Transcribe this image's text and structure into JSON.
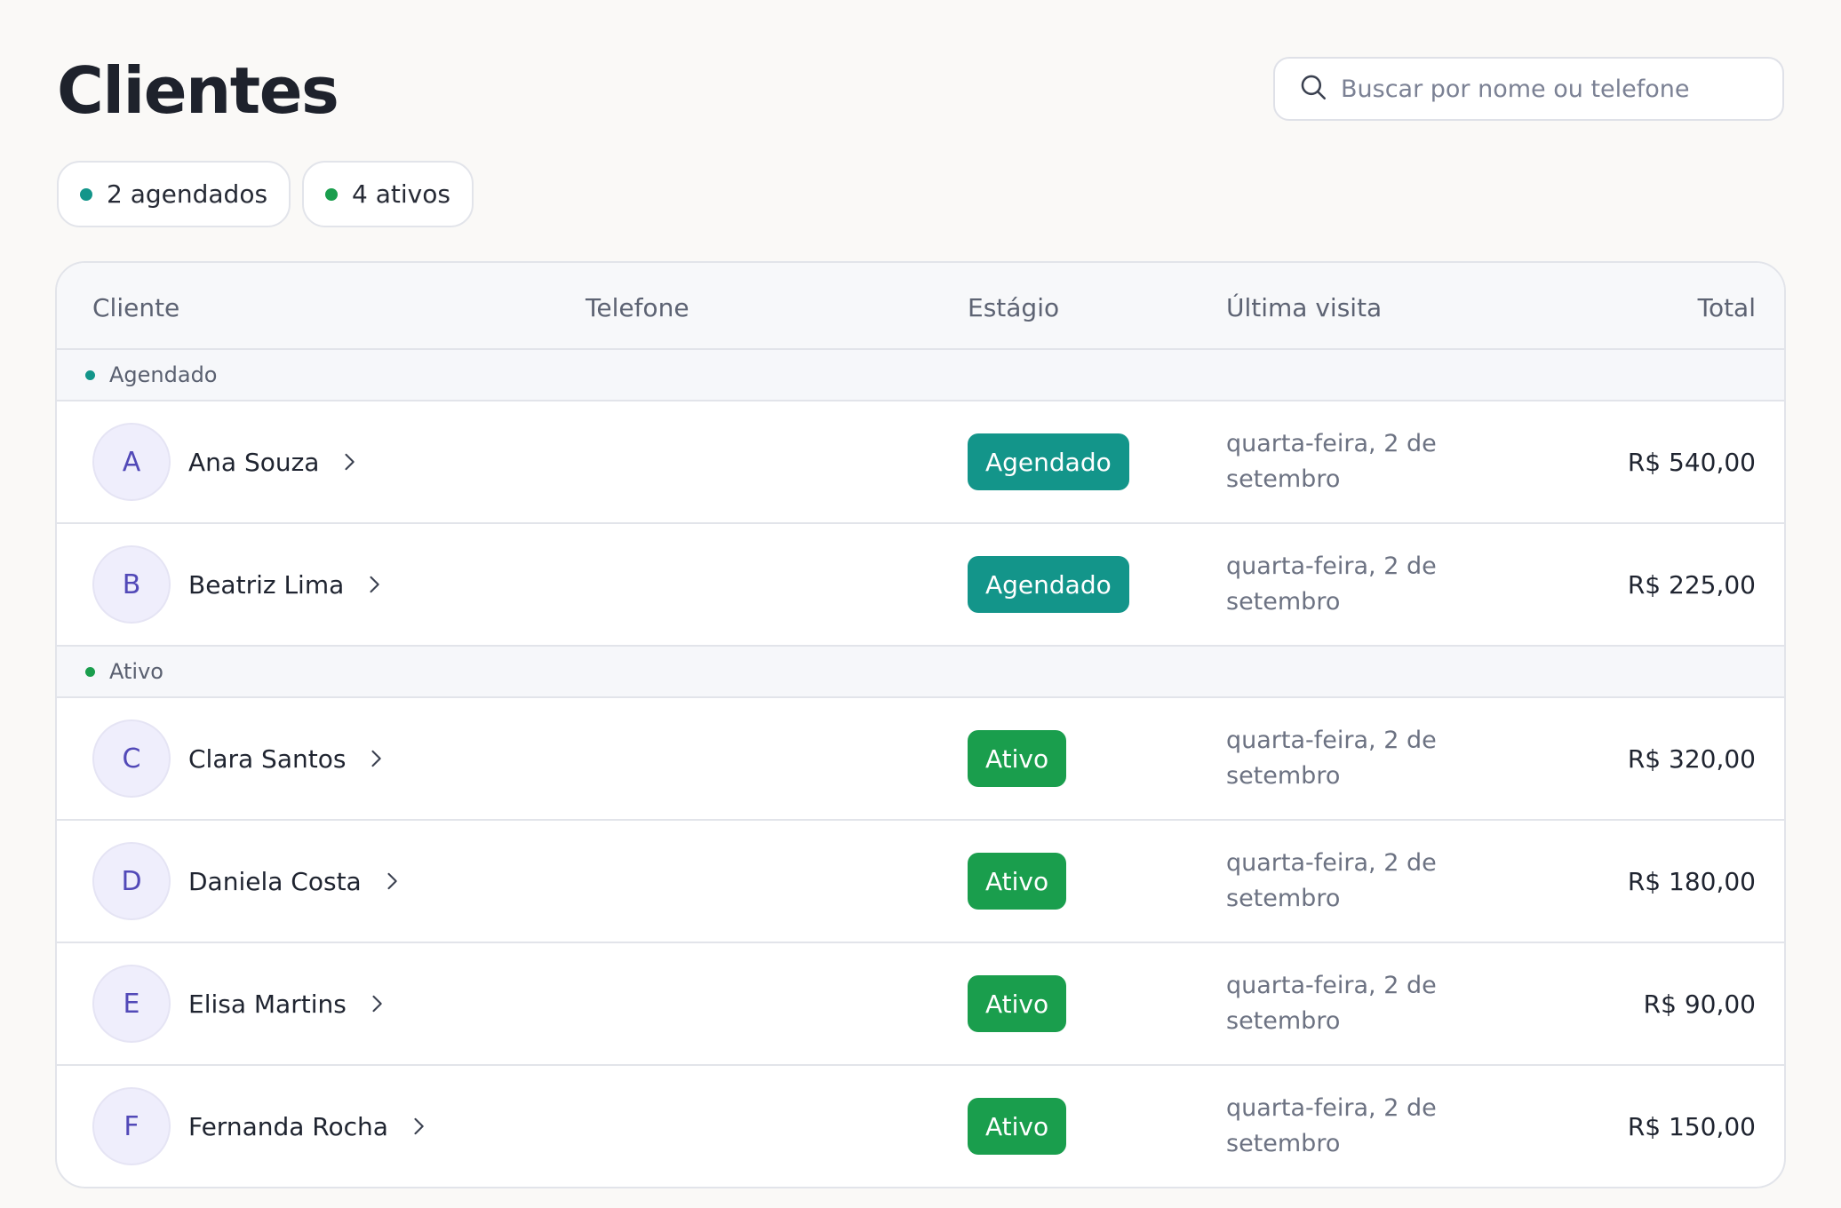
{
  "header": {
    "title": "Clientes",
    "search_placeholder": "Buscar por nome ou telefone"
  },
  "chips": [
    {
      "label": "2 agendados",
      "dot_color": "#13958a"
    },
    {
      "label": "4 ativos",
      "dot_color": "#1a9e4d"
    }
  ],
  "table": {
    "columns": {
      "cliente": "Cliente",
      "telefone": "Telefone",
      "estagio": "Estágio",
      "ultima_visita": "Última visita",
      "total": "Total"
    },
    "groups": [
      {
        "label": "Agendado",
        "color": "#13958a",
        "rows": [
          {
            "initial": "A",
            "name": "Ana Souza",
            "stage": "Agendado",
            "last_visit": "quarta-feira, 2 de setembro",
            "total": "R$ 540,00"
          },
          {
            "initial": "B",
            "name": "Beatriz Lima",
            "stage": "Agendado",
            "last_visit": "quarta-feira, 2 de setembro",
            "total": "R$ 225,00"
          }
        ]
      },
      {
        "label": "Ativo",
        "color": "#1a9e4d",
        "rows": [
          {
            "initial": "C",
            "name": "Clara Santos",
            "stage": "Ativo",
            "last_visit": "quarta-feira, 2 de setembro",
            "total": "R$ 320,00"
          },
          {
            "initial": "D",
            "name": "Daniela Costa",
            "stage": "Ativo",
            "last_visit": "quarta-feira, 2 de setembro",
            "total": "R$ 180,00"
          },
          {
            "initial": "E",
            "name": "Elisa Martins",
            "stage": "Ativo",
            "last_visit": "quarta-feira, 2 de setembro",
            "total": "R$ 90,00"
          },
          {
            "initial": "F",
            "name": "Fernanda Rocha",
            "stage": "Ativo",
            "last_visit": "quarta-feira, 2 de setembro",
            "total": "R$ 150,00"
          }
        ]
      }
    ]
  },
  "icons": {
    "search": "search-icon",
    "row_chevron": "chevron-right-icon"
  }
}
